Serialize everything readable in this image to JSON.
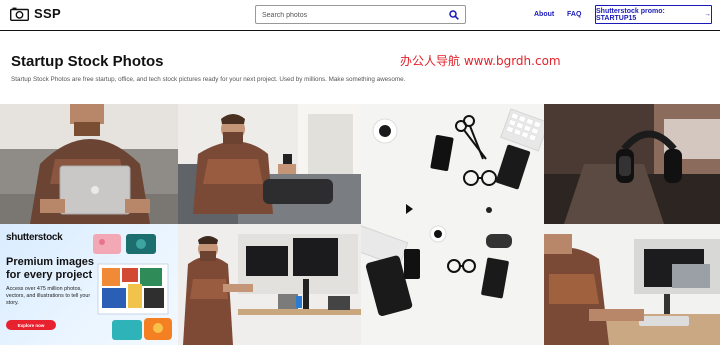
{
  "header": {
    "logo_text": "SSP",
    "search": {
      "placeholder": "Search photos",
      "value": ""
    },
    "nav": {
      "about": "About",
      "faq": "FAQ"
    },
    "promo": {
      "label": "Shutterstock promo: STARTUP15",
      "arrow": "→"
    }
  },
  "hero": {
    "title": "Startup Stock Photos",
    "description": "Startup Stock Photos are free startup, office, and tech stock pictures ready for your next project. Used by millions. Make something awesome.",
    "watermark": "办公人导航 www.bgrdh.com"
  },
  "ad": {
    "brand": "shutterstock",
    "headline": "Premium images for every project",
    "body": "Access over 475 million photos, vectors, and illustrations to tell your story.",
    "cta": "Explore now"
  },
  "photos": [
    {
      "name": "man-with-laptop-on-couch"
    },
    {
      "name": "man-on-sofa-with-phone"
    },
    {
      "name": "desk-flatlay-with-coffee-phone"
    },
    {
      "name": "headphones-on-desk"
    },
    {
      "name": "man-at-standing-desk"
    },
    {
      "name": "flatlay-phones-notebook"
    },
    {
      "name": "man-typing-at-monitor"
    }
  ],
  "colors": {
    "accent": "#1a1ab8",
    "ad_button": "#e8212e",
    "watermark": "#e0232a"
  }
}
